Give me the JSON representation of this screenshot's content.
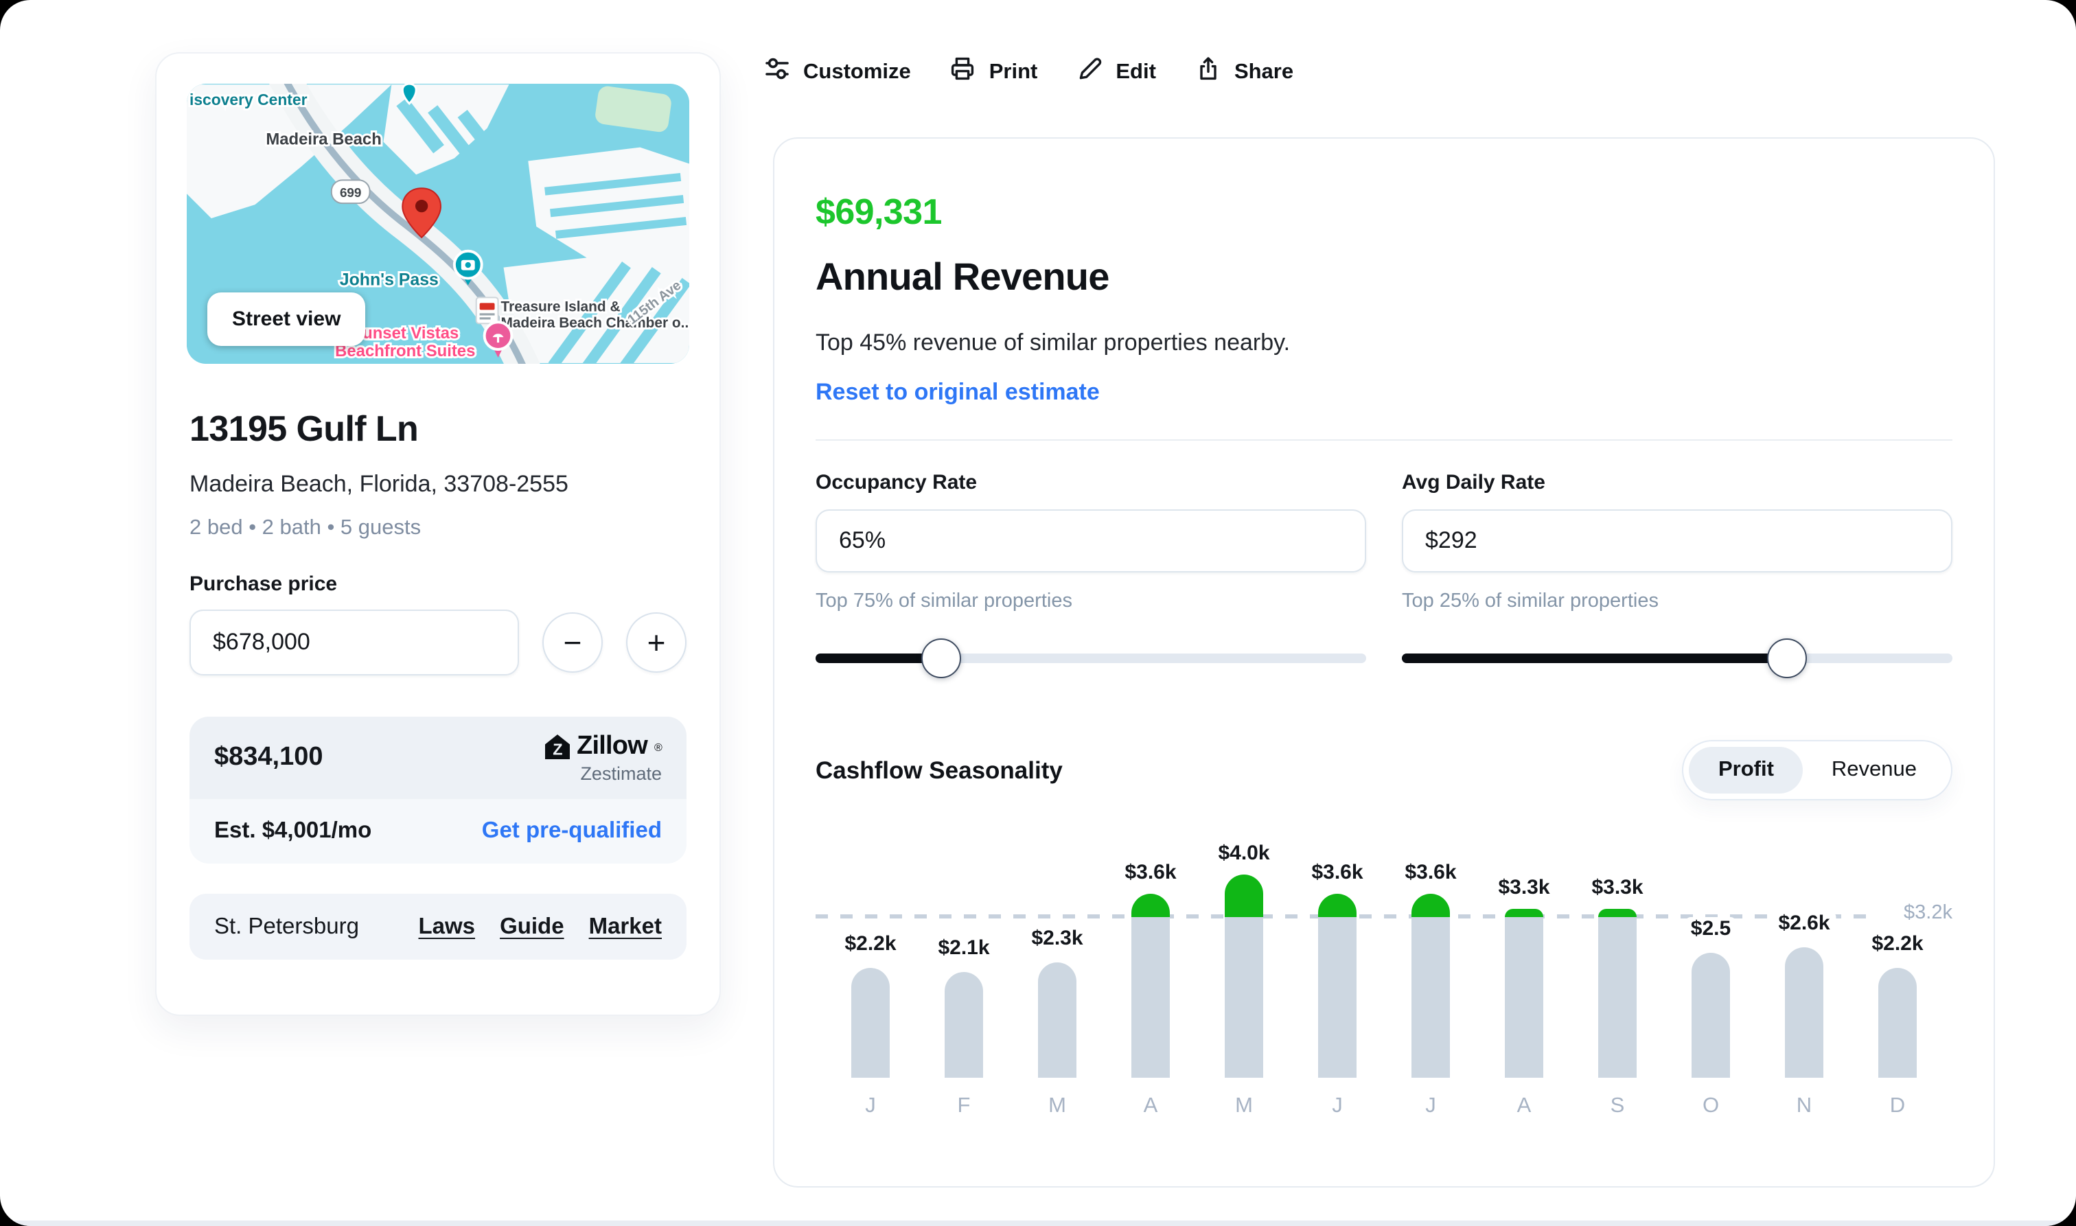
{
  "toolbar": {
    "items": [
      {
        "label": "Customize",
        "icon": "customize"
      },
      {
        "label": "Print",
        "icon": "print"
      },
      {
        "label": "Edit",
        "icon": "edit"
      },
      {
        "label": "Share",
        "icon": "share"
      }
    ]
  },
  "property_card": {
    "map": {
      "street_view_label": "Street view",
      "labels": {
        "discovery_center": "iscovery Center",
        "madeira_beach": "Madeira Beach",
        "route_badge": "699",
        "johns_pass": "John's Pass",
        "chamber_line1": "Treasure Island &",
        "chamber_line2": "Madeira Beach Chamber o...",
        "sunset_line1": "Sunset Vistas",
        "sunset_line2": "Beachfront Suites",
        "street_115th": "115th Ave"
      }
    },
    "address_line1": "13195 Gulf Ln",
    "address_line2": "Madeira Beach, Florida, 33708-2555",
    "specs": "2 bed • 2 bath • 5 guests",
    "purchase_price_label": "Purchase price",
    "purchase_price_value": "$678,000",
    "stepper": {
      "decrease": "−",
      "increase": "+"
    },
    "zestimate": {
      "value": "$834,100",
      "brand": "Zillow",
      "registered": "®",
      "brand_sub": "Zestimate"
    },
    "monthly": {
      "estimate": "Est. $4,001/mo",
      "link": "Get pre-qualified"
    },
    "market_row": {
      "city": "St. Petersburg",
      "links": [
        "Laws",
        "Guide",
        "Market"
      ]
    }
  },
  "revenue_panel": {
    "amount": "$69,331",
    "title": "Annual Revenue",
    "subtitle": "Top 45% revenue of similar properties nearby.",
    "reset_link": "Reset to original estimate",
    "occupancy": {
      "label": "Occupancy Rate",
      "value": "65%",
      "caption": "Top 75% of similar properties",
      "slider_pct": 23
    },
    "adr": {
      "label": "Avg Daily Rate",
      "value": "$292",
      "caption": "Top 25% of similar properties",
      "slider_pct": 70
    },
    "seasonality": {
      "title": "Cashflow Seasonality",
      "options": [
        "Profit",
        "Revenue"
      ],
      "active": "Profit"
    }
  },
  "chart_data": {
    "type": "bar",
    "title": "Cashflow Seasonality",
    "series_name": "Profit",
    "categories": [
      "J",
      "F",
      "M",
      "A",
      "M",
      "J",
      "J",
      "A",
      "S",
      "O",
      "N",
      "D"
    ],
    "values": [
      2200,
      2100,
      2300,
      3600,
      4000,
      3600,
      3600,
      3300,
      3300,
      2500,
      2600,
      2200
    ],
    "value_labels": [
      "$2.2k",
      "$2.1k",
      "$2.3k",
      "$3.6k",
      "$4.0k",
      "$3.6k",
      "$3.6k",
      "$3.3k",
      "$3.3k",
      "$2.5",
      "$2.6k",
      "$2.2k"
    ],
    "reference_line": {
      "value": 3200,
      "label": "$3.2k"
    },
    "ylim": [
      0,
      4000
    ],
    "grid": false,
    "legend": false,
    "bar_color": "#CDD7E1",
    "above_line_color": "#10B716"
  },
  "colors": {
    "accent_green": "#1CC62C",
    "bar_green": "#10B716",
    "link_blue": "#2E77F6",
    "bar_gray": "#CDD7E1",
    "dashed_line": "#C7D1DD",
    "secondary_text": "#7E8CA0",
    "map_water": "#7ED4E6"
  }
}
